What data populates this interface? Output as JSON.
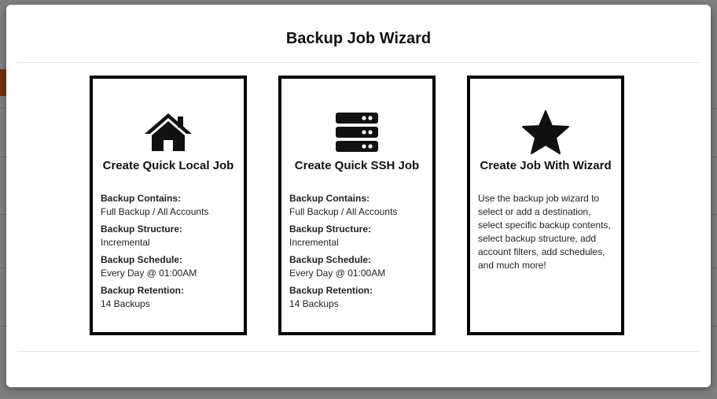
{
  "modal": {
    "title": "Backup Job Wizard"
  },
  "cards": [
    {
      "title": "Create Quick Local Job",
      "icon": "home-icon",
      "fields": [
        {
          "label": "Backup Contains:",
          "value": "Full Backup / All Accounts"
        },
        {
          "label": "Backup Structure:",
          "value": "Incremental"
        },
        {
          "label": "Backup Schedule:",
          "value": "Every Day @ 01:00AM"
        },
        {
          "label": "Backup Retention:",
          "value": "14 Backups"
        }
      ]
    },
    {
      "title": "Create Quick SSH Job",
      "icon": "server-icon",
      "fields": [
        {
          "label": "Backup Contains:",
          "value": "Full Backup / All Accounts"
        },
        {
          "label": "Backup Structure:",
          "value": "Incremental"
        },
        {
          "label": "Backup Schedule:",
          "value": "Every Day @ 01:00AM"
        },
        {
          "label": "Backup Retention:",
          "value": "14 Backups"
        }
      ]
    },
    {
      "title": "Create Job With Wizard",
      "icon": "star-icon",
      "description": "Use the backup job wizard to select or add a destination, select specific backup contents, select backup structure, add account filters, add schedules, and much more!"
    }
  ],
  "colors": {
    "overlay": "#808080",
    "card_border": "#000000",
    "accent": "#e8651e"
  }
}
